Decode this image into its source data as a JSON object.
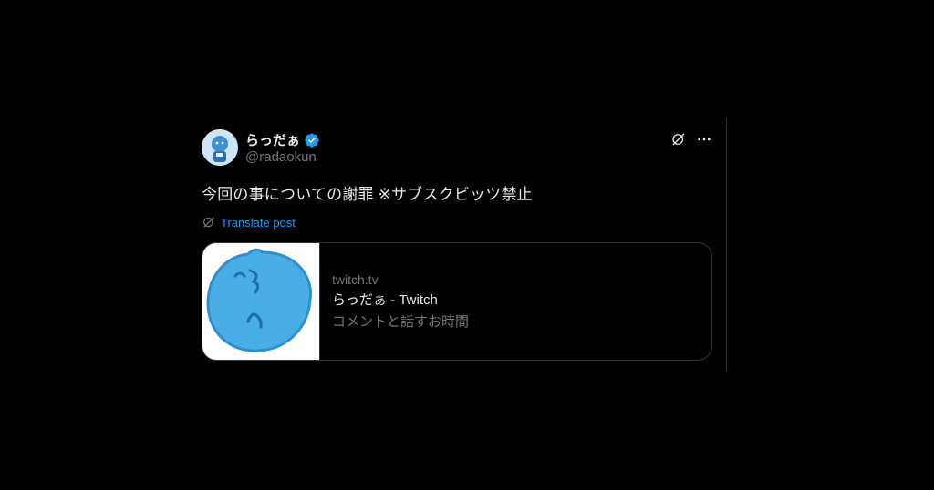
{
  "tweet": {
    "display_name": "らっだぁ",
    "handle": "@radaokun",
    "verified": true,
    "text": "今回の事についての謝罪 ※サブスクビッツ禁止",
    "translate_label": "Translate post"
  },
  "card": {
    "domain": "twitch.tv",
    "title": "らっだぁ - Twitch",
    "description": "コメントと話すお時間"
  },
  "icons": {
    "verified": "verified-badge-icon",
    "grok": "grok-icon",
    "more": "more-icon",
    "translate": "translate-icon"
  },
  "colors": {
    "background": "#000000",
    "text_primary": "#e7e9ea",
    "text_secondary": "#71767b",
    "link": "#1d9bf0",
    "border": "#2f3336",
    "verified": "#1d9bf0"
  }
}
